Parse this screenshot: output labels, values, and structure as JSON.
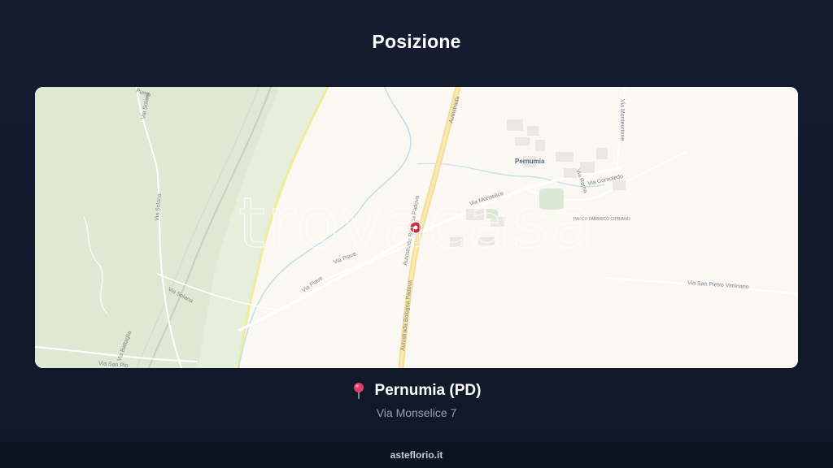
{
  "title": "Posizione",
  "map": {
    "watermark": "trovacasa",
    "place_labels": {
      "town": "Pernumia",
      "park": "PARCO FABBRICO CIPRIANO"
    },
    "road_labels": {
      "via_monselice": "Via Monselice",
      "via_piave_1": "Via Piave",
      "via_piave_2": "Via Piave",
      "via_solana_1": "Via Solana",
      "via_solana_2": "Via Solana",
      "via_solana_3": "Via Solana",
      "via_san_pietro_viminario": "Via San Pietro Viminario",
      "via_cornoledo": "Via Cornoledo",
      "via_roma": "Via Roma",
      "via_monteortone": "Via Monteortone",
      "autostrada_1": "Autostrada Bologna Padova",
      "autostrada_2": "Autostrada Bologna Padova",
      "autostrada_3": "Autostrada",
      "via_battaglia": "Via Battaglia",
      "via_san_pio": "Via San Pio",
      "pump": "Pump"
    }
  },
  "location": {
    "icon": "pin-icon",
    "name": "Pernumia (PD)",
    "address": "Via Monselice 7"
  },
  "footer": {
    "site": "asteflorio.it"
  }
}
